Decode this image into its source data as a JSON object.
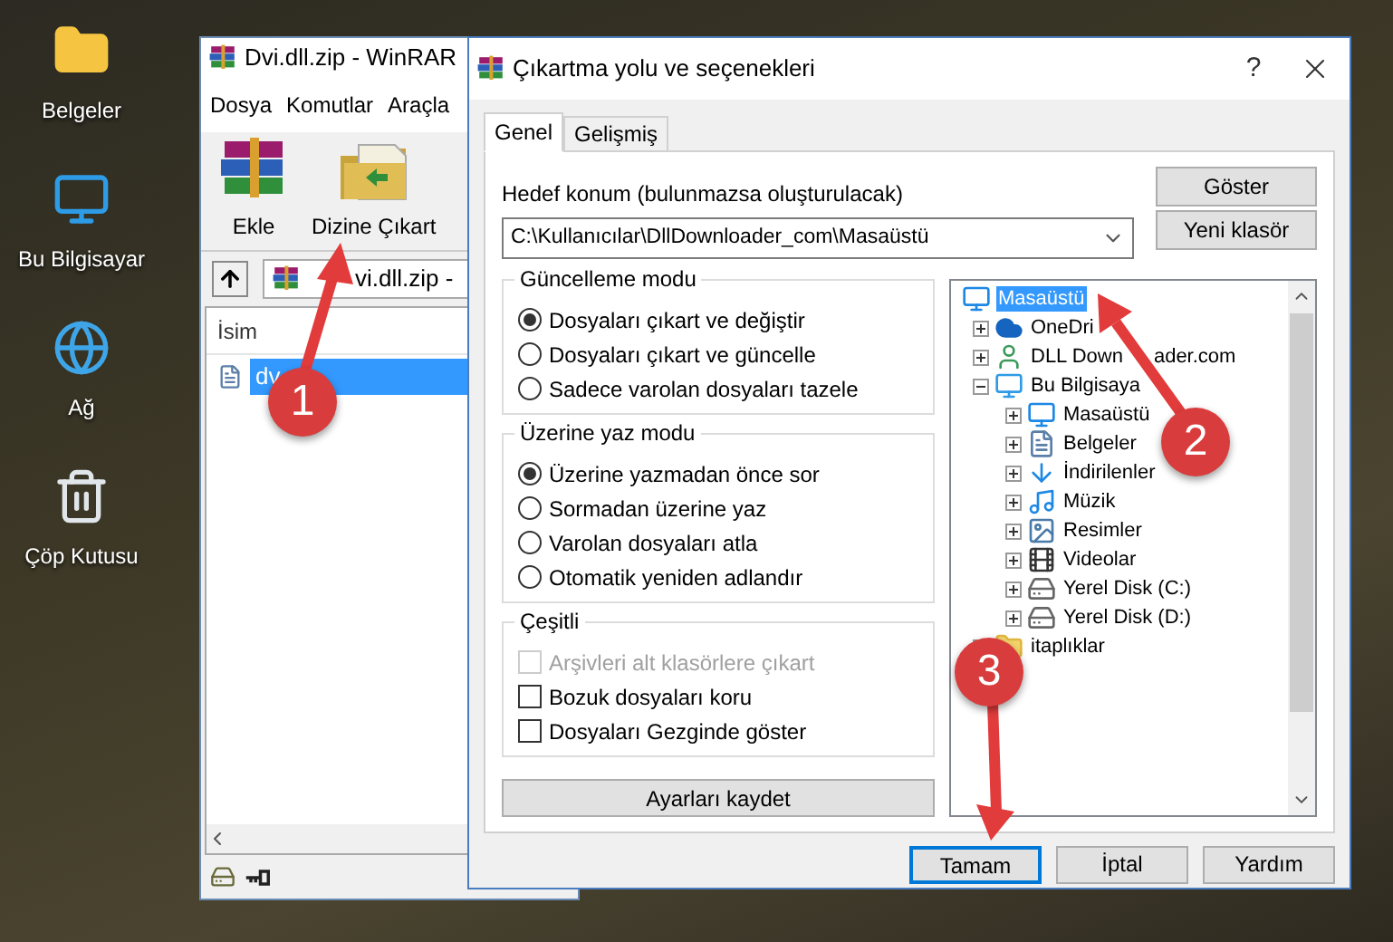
{
  "desktop_icons": [
    {
      "label": "Belgeler",
      "kind": "user-folder"
    },
    {
      "label": "Bu Bilgisayar",
      "kind": "computer"
    },
    {
      "label": "Ağ",
      "kind": "network"
    },
    {
      "label": "Çöp Kutusu",
      "kind": "recycle"
    }
  ],
  "winrar": {
    "title": "Dvi.dll.zip - WinRAR",
    "menu": [
      "Dosya",
      "Komutlar",
      "Araçla"
    ],
    "toolbar": [
      {
        "label": "Ekle",
        "kind": "add"
      },
      {
        "label": "Dizine Çıkart",
        "kind": "extract"
      }
    ],
    "path": "vi.dll.zip -",
    "column": "İsim",
    "rows": [
      {
        "name": "dv",
        "selected": true
      }
    ]
  },
  "dialog": {
    "title": "Çıkartma yolu ve seçenekleri",
    "help": "?",
    "tabs": [
      {
        "label": "Genel",
        "selected": true
      },
      {
        "label": "Gelişmiş",
        "selected": false
      }
    ],
    "destination": {
      "label": "Hedef konum (bulunmazsa oluşturulacak)",
      "value": "C:\\Kullanıcılar\\DllDownloader_com\\Masaüstü"
    },
    "side_buttons": [
      "Göster",
      "Yeni klasör"
    ],
    "groups": [
      {
        "title": "Güncelleme modu",
        "options": [
          {
            "kind": "radio",
            "label": "Dosyaları çıkart ve değiştir",
            "selected": true
          },
          {
            "kind": "radio",
            "label": "Dosyaları çıkart ve güncelle",
            "selected": false
          },
          {
            "kind": "radio",
            "label": "Sadece varolan dosyaları tazele",
            "selected": false
          }
        ]
      },
      {
        "title": "Üzerine yaz modu",
        "options": [
          {
            "kind": "radio",
            "label": "Üzerine yazmadan önce sor",
            "selected": true
          },
          {
            "kind": "radio",
            "label": "Sormadan üzerine yaz",
            "selected": false
          },
          {
            "kind": "radio",
            "label": "Varolan dosyaları atla",
            "selected": false
          },
          {
            "kind": "radio",
            "label": "Otomatik yeniden adlandır",
            "selected": false
          }
        ]
      },
      {
        "title": "Çeşitli",
        "options": [
          {
            "kind": "checkbox",
            "label": "Arşivleri alt klasörlere çıkart",
            "checked": false,
            "disabled": true
          },
          {
            "kind": "checkbox",
            "label": "Bozuk dosyaları koru",
            "checked": false,
            "disabled": false
          },
          {
            "kind": "checkbox",
            "label": "Dosyaları Gezginde göster",
            "checked": false,
            "disabled": false
          }
        ]
      }
    ],
    "save_button": "Ayarları kaydet",
    "tree": [
      {
        "label": "Masaüstü",
        "kind": "desktop",
        "selected": true,
        "children": [
          {
            "label": "OneDri",
            "kind": "cloud",
            "selected": false,
            "expanded": false
          },
          {
            "label": "DLL Down",
            "label_rest": "ader.com",
            "kind": "user",
            "selected": false,
            "expanded": false
          },
          {
            "label": "Bu Bilgisaya",
            "kind": "computer",
            "selected": false,
            "expanded": true,
            "children": [
              {
                "label": "Masaüstü",
                "kind": "desktop",
                "selected": false,
                "expanded": false
              },
              {
                "label": "Belgeler",
                "kind": "document",
                "selected": false,
                "expanded": false
              },
              {
                "label": "İndirilenler",
                "kind": "download",
                "selected": false,
                "expanded": false
              },
              {
                "label": "Müzik",
                "kind": "music",
                "selected": false,
                "expanded": false
              },
              {
                "label": "Resimler",
                "kind": "picture",
                "selected": false,
                "expanded": false
              },
              {
                "label": "Videolar",
                "kind": "video",
                "selected": false,
                "expanded": false
              },
              {
                "label": "Yerel Disk (C:)",
                "kind": "disk",
                "selected": false,
                "expanded": false
              },
              {
                "label": "Yerel Disk (D:)",
                "kind": "disk",
                "selected": false,
                "expanded": false
              }
            ]
          },
          {
            "label": "itaplıklar",
            "kind": "folder",
            "selected": false,
            "expanded": false
          }
        ]
      }
    ],
    "footer_buttons": [
      {
        "label": "Tamam",
        "default": true
      },
      {
        "label": "İptal",
        "default": false
      },
      {
        "label": "Yardım",
        "default": false
      }
    ]
  },
  "badges": [
    "1",
    "2",
    "3"
  ]
}
